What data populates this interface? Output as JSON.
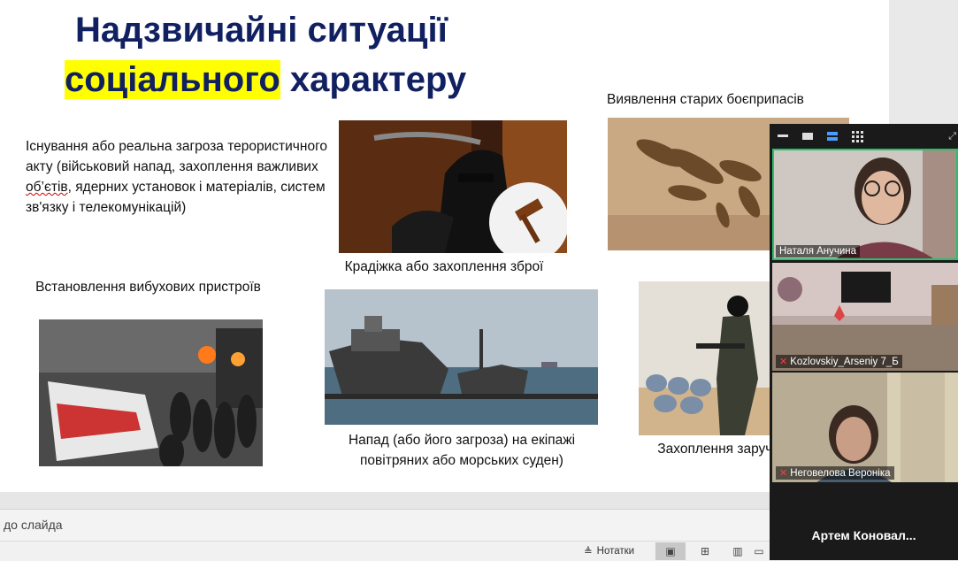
{
  "slide": {
    "title_line1": "Надзвичайні ситуації",
    "title_highlight": "соціального",
    "title_rest": " характеру",
    "body_part1": "Існування або реальна загроза терористичного акту (військовий напад, захоплення важливих ",
    "body_misspelled": "об’єтів",
    "body_part2": ", ядерних установок і матеріалів, систем зв'язку і телекомунікацій)",
    "captions": {
      "weapons": "Крадіжка або захоплення зброї",
      "munitions": "Виявлення старих боєприпасів",
      "explosives": "Встановлення  вибухових пристроїв",
      "ships": "Напад (або його загроза) на екіпажі повітряних або морських суден)",
      "hostages": "Захоплення заручників, викрадення"
    }
  },
  "notes": {
    "placeholder": "до слайда"
  },
  "status_bar": {
    "notes_label": "Нотатки"
  },
  "video_panel": {
    "participants": [
      {
        "name": "Наталя Анучина",
        "muted": false,
        "active": true
      },
      {
        "name": "Kozlovskiy_Arseniy 7_Б",
        "muted": true,
        "active": false
      },
      {
        "name": "Неговелова Вероніка",
        "muted": true,
        "active": false
      },
      {
        "name": "Артем  Коновал...",
        "muted": false,
        "active": false
      }
    ]
  },
  "colors": {
    "title": "#112060",
    "highlight": "#ffff00",
    "active_speaker": "#27c16a"
  }
}
